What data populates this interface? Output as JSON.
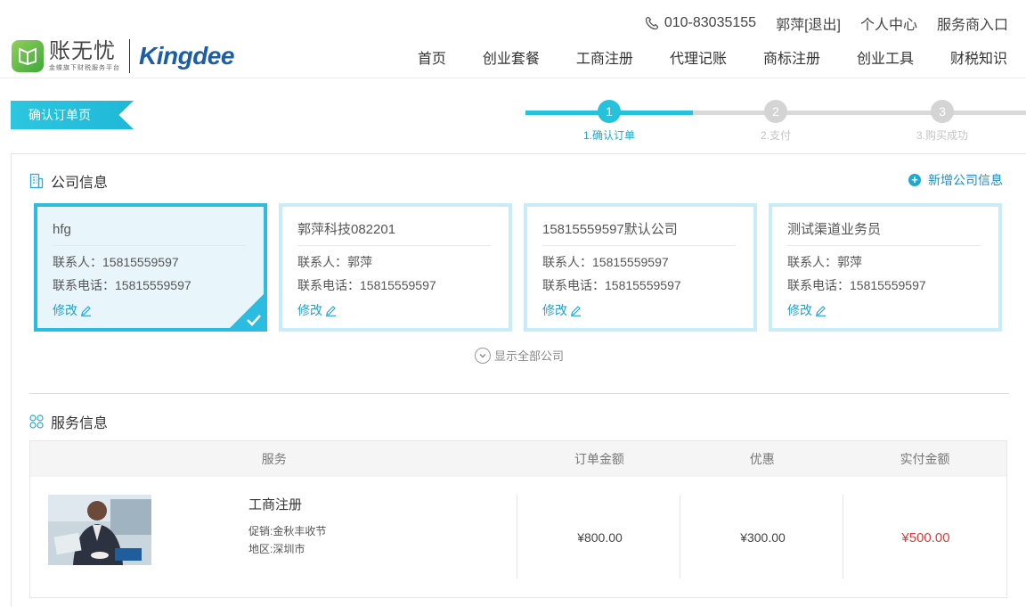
{
  "header": {
    "phone": "010-83035155",
    "user": "郭萍[退出]",
    "personal_center": "个人中心",
    "merchant_entry": "服务商入口",
    "logo_cn": "账无忧",
    "logo_sub": "金蝶旗下财税服务平台",
    "logo_brand": "Kingdee",
    "nav": [
      "首页",
      "创业套餐",
      "工商注册",
      "代理记账",
      "商标注册",
      "创业工具",
      "财税知识"
    ]
  },
  "page_tag": "确认订单页",
  "steps": [
    {
      "num": "1",
      "label": "1.确认订单",
      "active": true
    },
    {
      "num": "2",
      "label": "2.支付",
      "active": false
    },
    {
      "num": "3",
      "label": "3.购买成功",
      "active": false
    }
  ],
  "company_section": {
    "title": "公司信息",
    "add_label": "新增公司信息",
    "show_all": "显示全部公司",
    "cards": [
      {
        "name": "hfg",
        "contact": "联系人：15815559597",
        "phone": "联系电话：15815559597",
        "edit": "修改",
        "selected": true
      },
      {
        "name": "郭萍科技082201",
        "contact": "联系人：郭萍",
        "phone": "联系电话：15815559597",
        "edit": "修改",
        "selected": false
      },
      {
        "name": "15815559597默认公司",
        "contact": "联系人：15815559597",
        "phone": "联系电话：15815559597",
        "edit": "修改",
        "selected": false
      },
      {
        "name": "测试渠道业务员",
        "contact": "联系人：郭萍",
        "phone": "联系电话：15815559597",
        "edit": "修改",
        "selected": false
      }
    ]
  },
  "service_section": {
    "title": "服务信息",
    "columns": [
      "服务",
      "订单金额",
      "优惠",
      "实付金额"
    ],
    "item": {
      "title": "工商注册",
      "promo": "促销:金秋丰收节",
      "region": "地区:深圳市",
      "order_amount": "¥800.00",
      "discount": "¥300.00",
      "paid": "¥500.00"
    }
  },
  "colors": {
    "accent": "#2bbce0",
    "price_red": "#e03c3c",
    "brand_blue": "#1a5ea8"
  }
}
